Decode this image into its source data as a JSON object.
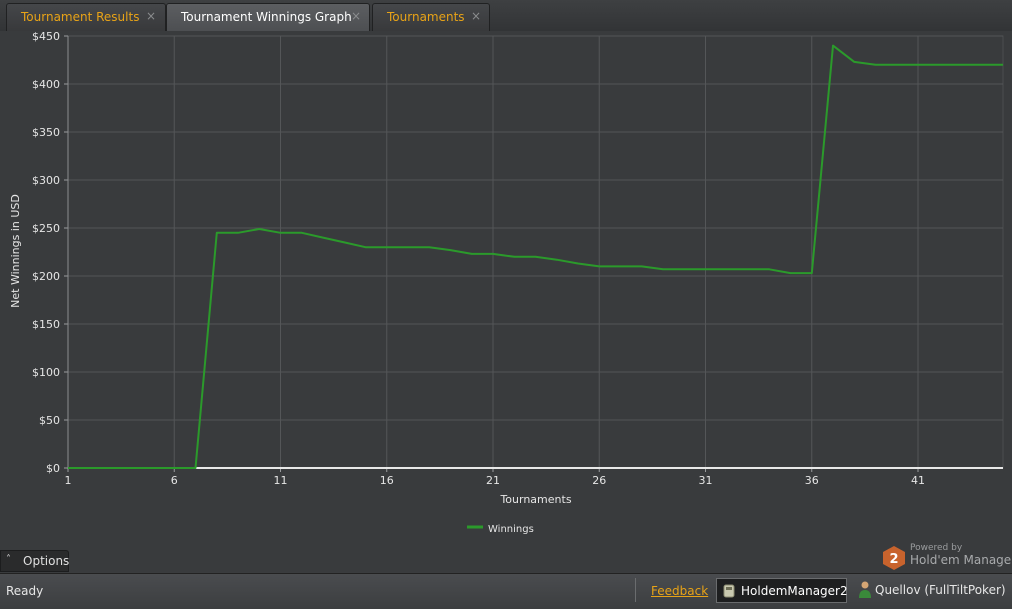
{
  "tabs": [
    {
      "label": "Tournament Results",
      "close": "×",
      "active": false
    },
    {
      "label": "Tournament Winnings Graph",
      "close": "×",
      "active": true
    },
    {
      "label": "Tournaments",
      "close": "×",
      "active": false
    }
  ],
  "options": {
    "chevron": "˄",
    "label": "Options"
  },
  "branding": {
    "powered": "Powered by",
    "name": "Hold'em Manager",
    "logo_text": "2",
    "logo_color": "#c8632d"
  },
  "statusbar": {
    "status": "Ready",
    "feedback": "Feedback",
    "database": "HoldemManager2",
    "player": "Quellov (FullTiltPoker)"
  },
  "colors": {
    "accent": "#e8a317",
    "line": "#2b9a2b",
    "zero_line": "#e8e8e8",
    "grid": "#545658"
  },
  "chart_data": {
    "type": "line",
    "xlabel": "Tournaments",
    "ylabel": "Net Winnings in USD",
    "xlim": [
      1,
      45
    ],
    "ylim": [
      0,
      450
    ],
    "x_ticks": [
      1,
      6,
      11,
      16,
      21,
      26,
      31,
      36,
      41
    ],
    "y_ticks": [
      0,
      50,
      100,
      150,
      200,
      250,
      300,
      350,
      400,
      450
    ],
    "y_tick_labels": [
      "$0",
      "$50",
      "$100",
      "$150",
      "$200",
      "$250",
      "$300",
      "$350",
      "$400",
      "$450"
    ],
    "grid": true,
    "legend_position": "bottom",
    "series": [
      {
        "name": "Winnings",
        "color": "#2b9a2b",
        "x": [
          1,
          2,
          3,
          4,
          5,
          6,
          7,
          8,
          9,
          10,
          11,
          12,
          13,
          14,
          15,
          16,
          17,
          18,
          19,
          20,
          21,
          22,
          23,
          24,
          25,
          26,
          27,
          28,
          29,
          30,
          31,
          32,
          33,
          34,
          35,
          36,
          37,
          38,
          39,
          40,
          41,
          42,
          43,
          44,
          45
        ],
        "y": [
          0,
          0,
          0,
          0,
          0,
          0,
          0,
          245,
          245,
          249,
          245,
          245,
          240,
          235,
          230,
          230,
          230,
          230,
          227,
          223,
          223,
          220,
          220,
          217,
          213,
          210,
          210,
          210,
          207,
          207,
          207,
          207,
          207,
          207,
          203,
          203,
          440,
          423,
          420,
          420,
          420,
          420,
          420,
          420,
          420
        ]
      }
    ]
  }
}
